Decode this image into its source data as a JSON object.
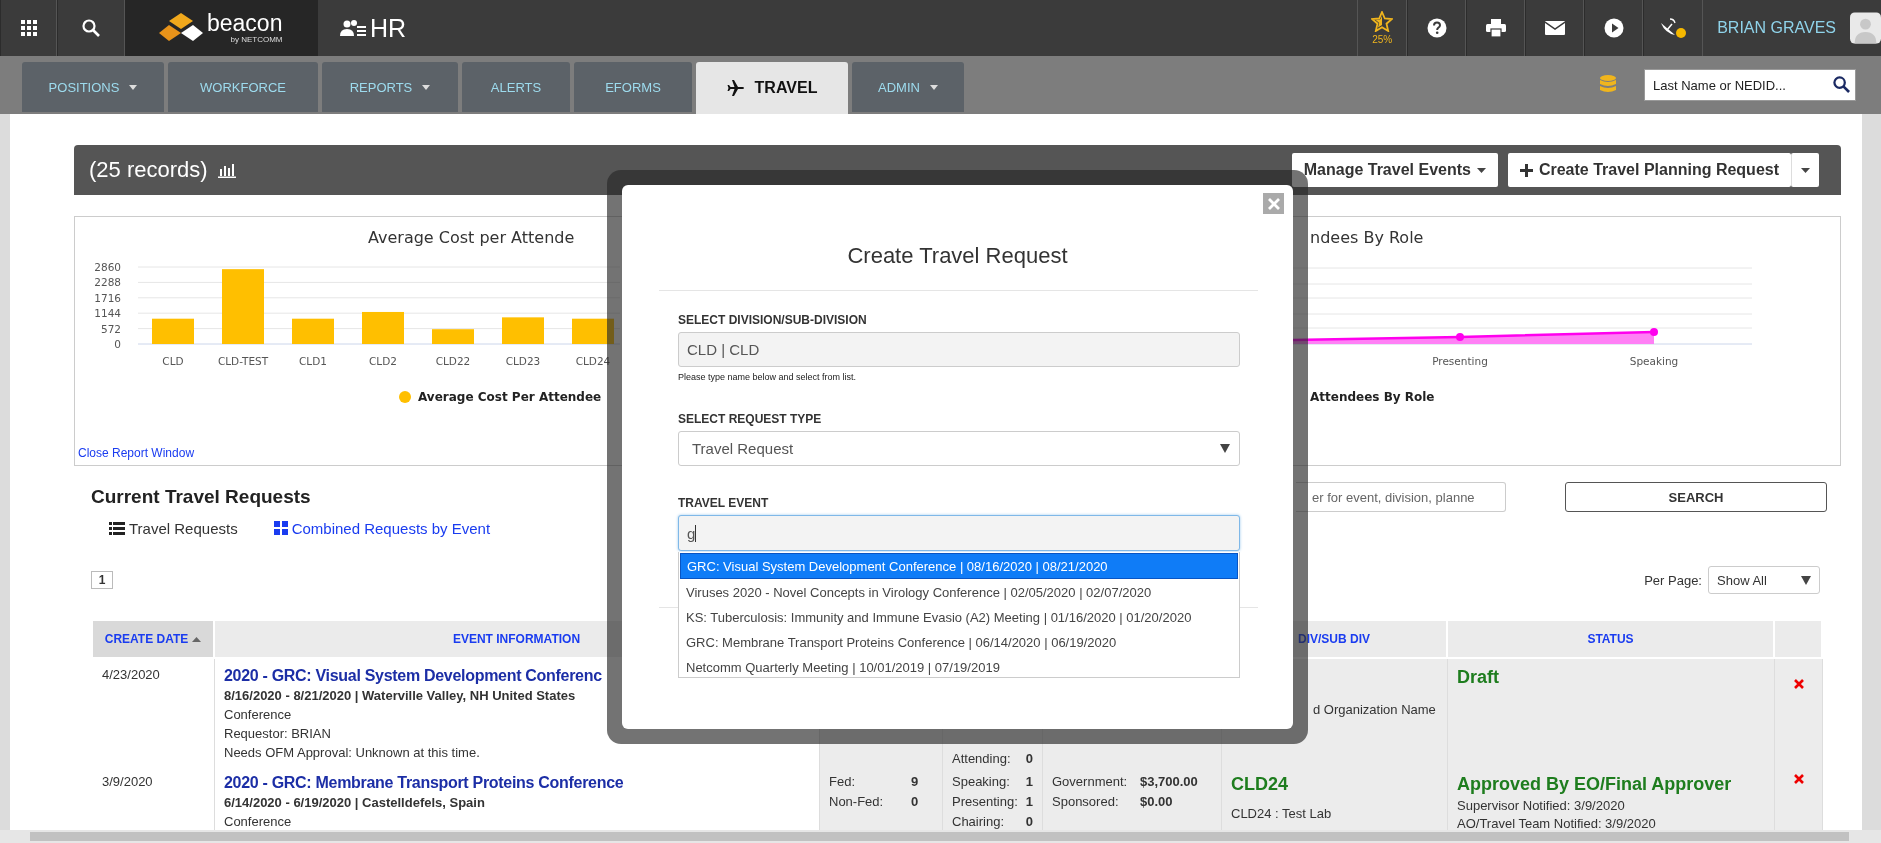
{
  "header": {
    "brand": "beacon",
    "brand_tagline": "by NETCOMM",
    "module": "HR",
    "score": "25%",
    "user": "BRIAN GRAVES"
  },
  "nav": {
    "tabs": [
      {
        "label": "POSITIONS",
        "dropdown": true,
        "selected": false
      },
      {
        "label": "WORKFORCE",
        "dropdown": false,
        "selected": false
      },
      {
        "label": "REPORTS",
        "dropdown": true,
        "selected": false
      },
      {
        "label": "ALERTS",
        "dropdown": false,
        "selected": false
      },
      {
        "label": "EFORMS",
        "dropdown": false,
        "selected": false
      },
      {
        "label": "TRAVEL",
        "dropdown": false,
        "selected": true
      },
      {
        "label": "ADMIN",
        "dropdown": true,
        "selected": false
      }
    ],
    "search": {
      "placeholder": "Last Name or NEDID..."
    }
  },
  "records_bar": {
    "count": "(25 records)",
    "buttons": [
      {
        "label": "Manage Travel Events",
        "kind": "dropdown"
      },
      {
        "label": "Create Travel Planning Request",
        "kind": "split"
      }
    ]
  },
  "reports": {
    "cost_chart": {
      "chart_data": {
        "type": "bar",
        "title": "Average Cost per Attende",
        "categories": [
          "CLD",
          "CLD-TEST",
          "CLD1",
          "CLD2",
          "CLD22",
          "CLD23",
          "CLD24"
        ],
        "series": [
          {
            "name": "Average Cost Per Attendee",
            "color": "#ffbf00",
            "values": [
              940,
              2780,
              940,
              1190,
              550,
              990,
              940
            ]
          }
        ],
        "ylim": [
          0,
          2860
        ],
        "grid": true,
        "yticks": [
          0,
          572,
          1144,
          1716,
          2288,
          2860
        ]
      }
    },
    "role_chart": {
      "title": "ndees By Role",
      "x_labels": [
        "Presenting",
        "Speaking"
      ],
      "legend": "Attendees By Role"
    },
    "close_link": "Close Report Window"
  },
  "list": {
    "title": "Current Travel Requests",
    "views": [
      {
        "label": "Travel Requests",
        "selected": true
      },
      {
        "label": "Combined Requests by Event",
        "selected": false
      }
    ],
    "search": {
      "placeholder": "er for event, division, planne"
    },
    "search_button": "SEARCH",
    "pages": [
      {
        "label": "1",
        "selected": true
      }
    ],
    "per_page": {
      "label": "Per Page:",
      "value": "Show All"
    }
  },
  "table": {
    "columns": [
      {
        "label": "CREATE DATE",
        "sorted": true
      },
      {
        "label": "EVENT INFORMATION",
        "sorted": false
      },
      {
        "label": "DIV/SUB DIV",
        "sorted": false
      },
      {
        "label": "STATUS",
        "sorted": false
      }
    ],
    "rows": [
      {
        "date": "4/23/2020",
        "title": "2020 - GRC: Visual System Development Conferenc",
        "dates_place": "8/16/2020 - 8/21/2020 | Waterville Valley, NH United States",
        "type": "Conference",
        "lines": [
          "Requestor: BRIAN",
          "Needs OFM Approval: Unknown at this time."
        ],
        "roles": [
          {
            "label": "Attending:",
            "value": "0"
          }
        ],
        "div": {
          "name": "d Organization Name"
        },
        "status": {
          "title": "Draft"
        }
      },
      {
        "date": "3/9/2020",
        "title": "2020 - GRC: Membrane Transport Proteins Conference",
        "dates_place": "6/14/2020 - 6/19/2020 | Castelldefels, Spain",
        "type": "Conference",
        "attendees": [
          {
            "label": "Fed:",
            "value": "9"
          },
          {
            "label": "Non-Fed:",
            "value": "0"
          }
        ],
        "roles": [
          {
            "label": "Speaking:",
            "value": "1"
          },
          {
            "label": "Presenting:",
            "value": "1"
          },
          {
            "label": "Chairing:",
            "value": "0"
          }
        ],
        "funding": [
          {
            "label": "Government:",
            "value": "$3,700.00"
          },
          {
            "label": "Sponsored:",
            "value": "$0.00"
          }
        ],
        "div": {
          "code": "CLD24",
          "name": "CLD24 : Test Lab"
        },
        "status": {
          "title": "Approved By EO/Final Approver",
          "notes": [
            "Supervisor Notified: 3/9/2020",
            "AO/Travel Team Notified: 3/9/2020"
          ]
        }
      }
    ]
  },
  "modal": {
    "title": "Create Travel Request",
    "fields": [
      {
        "kind": "text",
        "label": "SELECT DIVISION/SUB-DIVISION",
        "value": "CLD | CLD",
        "hint": "Please type name below and select from list."
      },
      {
        "kind": "select",
        "label": "SELECT REQUEST TYPE",
        "value": "Travel Request"
      },
      {
        "kind": "autocomplete",
        "label": "TRAVEL EVENT",
        "value": "g",
        "suggestions": [
          {
            "label": "GRC: Visual System Development Conference | 08/16/2020 | 08/21/2020",
            "selected": true
          },
          {
            "label": "Viruses 2020 - Novel Concepts in Virology Conference | 02/05/2020 | 02/07/2020",
            "selected": false
          },
          {
            "label": "KS: Tuberculosis: Immunity and Immune Evasio (A2) Meeting | 01/16/2020 | 01/20/2020",
            "selected": false
          },
          {
            "label": "GRC: Membrane Transport Proteins Conference | 06/14/2020 | 06/19/2020",
            "selected": false
          },
          {
            "label": "Netcomm Quarterly Meeting | 10/01/2019 | 07/19/2019",
            "selected": false
          }
        ]
      }
    ]
  }
}
